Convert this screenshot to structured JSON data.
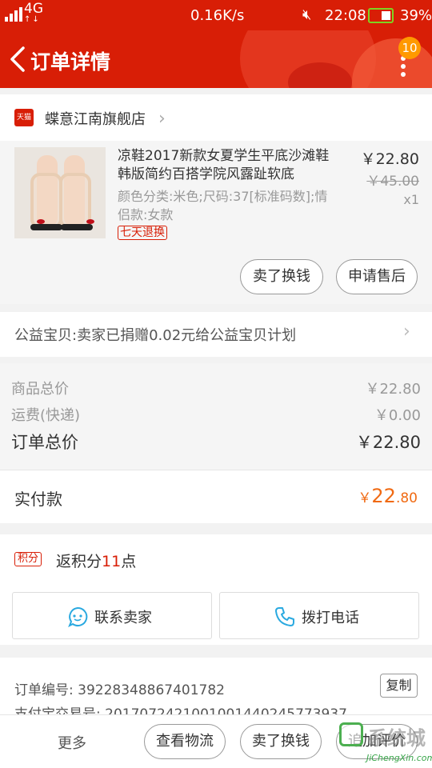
{
  "status_bar": {
    "network": "4G",
    "speed": "0.16K/s",
    "time": "22:08",
    "battery": "39%",
    "mute_icon": "×"
  },
  "nav": {
    "title": "订单详情",
    "badge_count": "10"
  },
  "shop": {
    "logo_text": "天猫",
    "name": "蝶意江南旗舰店"
  },
  "product": {
    "title": "凉鞋2017新款女夏学生平底沙滩鞋韩版简约百搭学院风露趾软底",
    "spec": "颜色分类:米色;尺码:37[标准码数];情侣款:女款",
    "return_tag": "七天退换",
    "price": "￥22.80",
    "original_price": "￥45.00",
    "quantity": "x1",
    "btn_sell": "卖了换钱",
    "btn_aftersale": "申请售后"
  },
  "charity": {
    "text": "公益宝贝:卖家已捐赠0.02元给公益宝贝计划"
  },
  "totals": {
    "goods_label": "商品总价",
    "goods_value": "￥22.80",
    "shipping_label": "运费(快递)",
    "shipping_value": "￥0.00",
    "order_label": "订单总价",
    "order_value": "￥22.80",
    "paid_label": "实付款",
    "paid_currency": "￥",
    "paid_int": "22",
    "paid_dec": ".80"
  },
  "points": {
    "tag": "积分",
    "prefix": "返积分",
    "count": "11",
    "suffix": "点",
    "contact_seller": "联系卖家",
    "call_phone": "拨打电话"
  },
  "order_info": {
    "number_line": "订单编号: 39228348867401782",
    "alipay_line": "支付宝交易号: 2017072421001001440245773937",
    "copy_label": "复制"
  },
  "bottom_bar": {
    "more": "更多",
    "logistics": "查看物流",
    "sell": "卖了换钱",
    "add_review": "追加评价"
  },
  "watermark": {
    "text_cn": "系统城",
    "text_en": "JiChengXin.com"
  },
  "colors": {
    "brand_red": "#d81e06",
    "paid_orange": "#f06a13",
    "badge_orange": "#ff9900"
  }
}
